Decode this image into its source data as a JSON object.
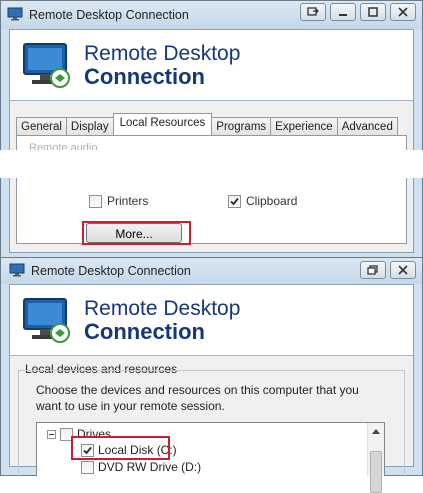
{
  "window1": {
    "title": "Remote Desktop Connection",
    "banner_line1": "Remote Desktop",
    "banner_line2": "Connection",
    "tabs": [
      {
        "label": "General"
      },
      {
        "label": "Display"
      },
      {
        "label": "Local Resources",
        "active": true
      },
      {
        "label": "Programs"
      },
      {
        "label": "Experience"
      },
      {
        "label": "Advanced"
      }
    ],
    "faded_section": "Remote audio",
    "printers_label": "Printers",
    "printers_checked": false,
    "clipboard_label": "Clipboard",
    "clipboard_checked": true,
    "more_button": "More..."
  },
  "window2": {
    "title": "Remote Desktop Connection",
    "banner_line1": "Remote Desktop",
    "banner_line2": "Connection",
    "section_title": "Local devices and resources",
    "description": "Choose the devices and resources on this computer that you want to use in your remote session.",
    "tree": {
      "drives_label": "Drives",
      "drives_checked": false,
      "local_disk_label": "Local Disk (C:)",
      "local_disk_checked": true,
      "dvd_label": "DVD RW Drive (D:)",
      "dvd_checked": false
    }
  },
  "colors": {
    "highlight": "#cc1f2e",
    "brand_title": "#16387a",
    "chrome": "#cfe0ee"
  }
}
